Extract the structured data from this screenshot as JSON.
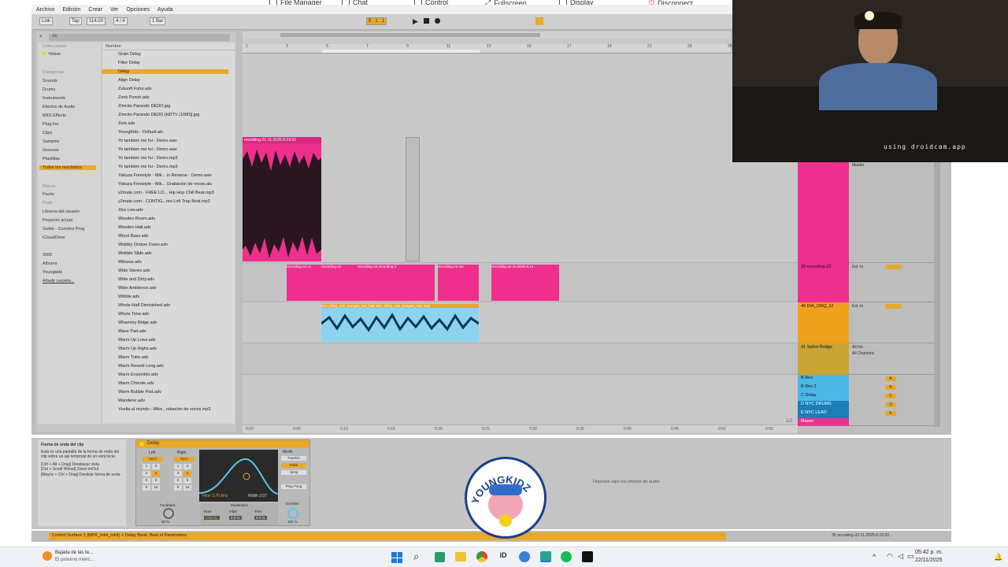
{
  "remote_toolbar": {
    "file_manager": "File Manager",
    "chat": "Chat",
    "control": "Control",
    "fullscreen": "Fullscreen",
    "display": "Display",
    "disconnect": "Disconnect"
  },
  "menu": [
    "Archivo",
    "Edición",
    "Crear",
    "Ver",
    "Opciones",
    "Ayuda"
  ],
  "transport": {
    "link": "Link",
    "tap": "Tap",
    "tempo": "114.00",
    "meter": "4 / 4",
    "bar": "1 Bar",
    "position": "5 . 1 . 1"
  },
  "browser": {
    "search": "de",
    "collections_header": "Colecciones",
    "collections": [
      "Yellow"
    ],
    "categories_header": "Categorías",
    "categories": [
      "Sounds",
      "Drums",
      "Instruments",
      "Efectos de Audio",
      "MIDI Effects",
      "Plug-Ins",
      "Clips",
      "Samples",
      "Grooves",
      "Plantillas",
      "Todos los resultados"
    ],
    "places_header": "Places",
    "places": [
      "Packs",
      "Push",
      "Librería del usuario",
      "Proyecto actual",
      "Goble - Corridos Prog",
      "iCloudDrive",
      "2005",
      "Albums",
      "Youngkidz",
      "Añadir carpeta..."
    ],
    "name_header": "Nombre",
    "files": [
      "Grain Delay",
      "Filter Delay",
      "Delay",
      "Align Delay",
      "Zukunft Futur.adv",
      "Zonk Punch.adv",
      "Zimcito Parando DEDO.jpg",
      "Zimcito Parando DEDO [HDTV (1080)].jpg",
      "Zerk.adv",
      "YoungKidz - Default.als",
      "Yo tambien me fui - Demo.wav",
      "Yo tambien me fui - Demo.wav",
      "Yo tambien me fui - Demo.mp3",
      "Yo tambien me fui - Demo.mp3",
      "Yakuza Freestyle - Mik... in Reverse - Demo.wav",
      "Yakuza Freestyle - Mik... Grabacion de voces.als",
      "y2mate.com - FREE LO... Hip Hop Chill Beat.mp3",
      "y2mate.com - CONTIG...ree Lofi Trap Beat.mp3",
      "Xtra Low.adv",
      "Wooden Room.adv",
      "Wooden Hall.adv",
      "Worst Bass.adv",
      "Wobbly Octave Down.adv",
      "Wobble Slide.adv",
      "Witness.adv",
      "Wide Stereo.adv",
      "Wide and Dirty.adv",
      "Wide Ambience.adv",
      "Wibble.adv",
      "Whole-Half Diminished.adv",
      "Whole Tone.adv",
      "Whammy Ridge.adv",
      "Wave Pad.adv",
      "Warm Up Lows.adv",
      "Warm Up Highs.adv",
      "Warm Tube.adv",
      "Warm Reverb Long.adv",
      "Warm Ensemble.adv",
      "Warm Chorale.adv",
      "Warm Bubble Pad.adv",
      "Wanderer.adv",
      "Vuelta al mundo - Mike...robación de voces.mp3"
    ]
  },
  "clips": {
    "top": "recording-21-11-2025-5:19:52",
    "r1": "recording-22-11",
    "r2": "recording-22",
    "r3": "recording-22 recording-2",
    "r4": "recording-22 rec",
    "r5": "recording-22-11-2025-5:19-",
    "blue": "DIA_ORQ_125_trumpet_mid_latin  DIA_ORQ_125_trumpet_mid_latin"
  },
  "tracks": [
    {
      "name": "39 recording-22",
      "color": "#ee2f8d"
    },
    {
      "name": "40 DIA_ORQ_12",
      "color": "#f1a21c"
    },
    {
      "name": "41 Splice Bridge",
      "color": "#caa335"
    },
    {
      "name": "B Rev",
      "color": "#4bb8e6"
    },
    {
      "name": "B Rev 2",
      "color": "#4bb8e6"
    },
    {
      "name": "C Delay",
      "color": "#4bb8e6"
    },
    {
      "name": "D NYC DRUMS",
      "color": "#1b7fb5"
    },
    {
      "name": "E NYC LEAD",
      "color": "#1b7fb5"
    },
    {
      "name": "Master",
      "color": "#ee2f8d"
    }
  ],
  "mixer": {
    "ext_in": "Ext. In",
    "all_ins": "All Ins",
    "all_channels": "All Channels",
    "master": "Master",
    "auto": "Auto",
    "off": "Off",
    "in": "In",
    "inf": "-inf",
    "post": "Post",
    "sends": [
      "A",
      "B",
      "C",
      "D",
      "E"
    ],
    "pager": "1/2"
  },
  "ruler_ticks": [
    "1",
    "3",
    "5",
    "7",
    "9",
    "11",
    "13",
    "15",
    "17",
    "19",
    "21",
    "23",
    "25"
  ],
  "time_ticks": [
    "0:00",
    "0:05",
    "0:10",
    "0:15",
    "0:20",
    "0:25",
    "0:30",
    "0:35",
    "0:40",
    "0:45",
    "0:50",
    "0:55"
  ],
  "info": {
    "title": "Forma de onda del clip",
    "body": "Esta es una pantalla de la forma de onda del clip sobre un eje temporal de un reloj local.",
    "shortcuts": "[Ctrl + Alt + Drag] Desplazar vista\n[Ctrl + Scroll Wheel] Zoom in/Out\n[Mayús + Ctrl + Drag] Deslizar forma de onda"
  },
  "device": {
    "name": "Delay",
    "left": "Left",
    "right": "Right",
    "sync": "Sync",
    "mode": "Mode",
    "repitch": "Repitch",
    "fade": "Fade",
    "jump": "Jump",
    "filter": "Filter",
    "filter_val": "1.70 kHz",
    "width": "Width",
    "width_val": "3.07",
    "feedback": "Feedback",
    "feedback_val": "50 %",
    "modulation": "Modulation",
    "rate": "Rate",
    "rate_val": "0.50 Hz",
    "mfilter": "Filter",
    "mfilter_val": "0.0 %",
    "time": "Time",
    "time_val": "0.0 %",
    "pingpong": "Ping Pong",
    "drywet": "Dry/Wet",
    "drywet_val": "100 %"
  },
  "drop_hint": "Deposite aquí los efectos de audio",
  "status_msg": "Control Surface 1 (MPK_mini_mkII) > Delay Bank: Best of Parameters",
  "status_right": "39 recording-22-11-2025-5:19:52...",
  "webcam_watermark": "using droidcam.app",
  "taskbar": {
    "weather_title": "Bajada de las te...",
    "weather_sub": "El próximo miérc...",
    "time": "05:42 p. m.",
    "date": "22/11/2025"
  },
  "logo_text": "YOUNGKIDZ"
}
